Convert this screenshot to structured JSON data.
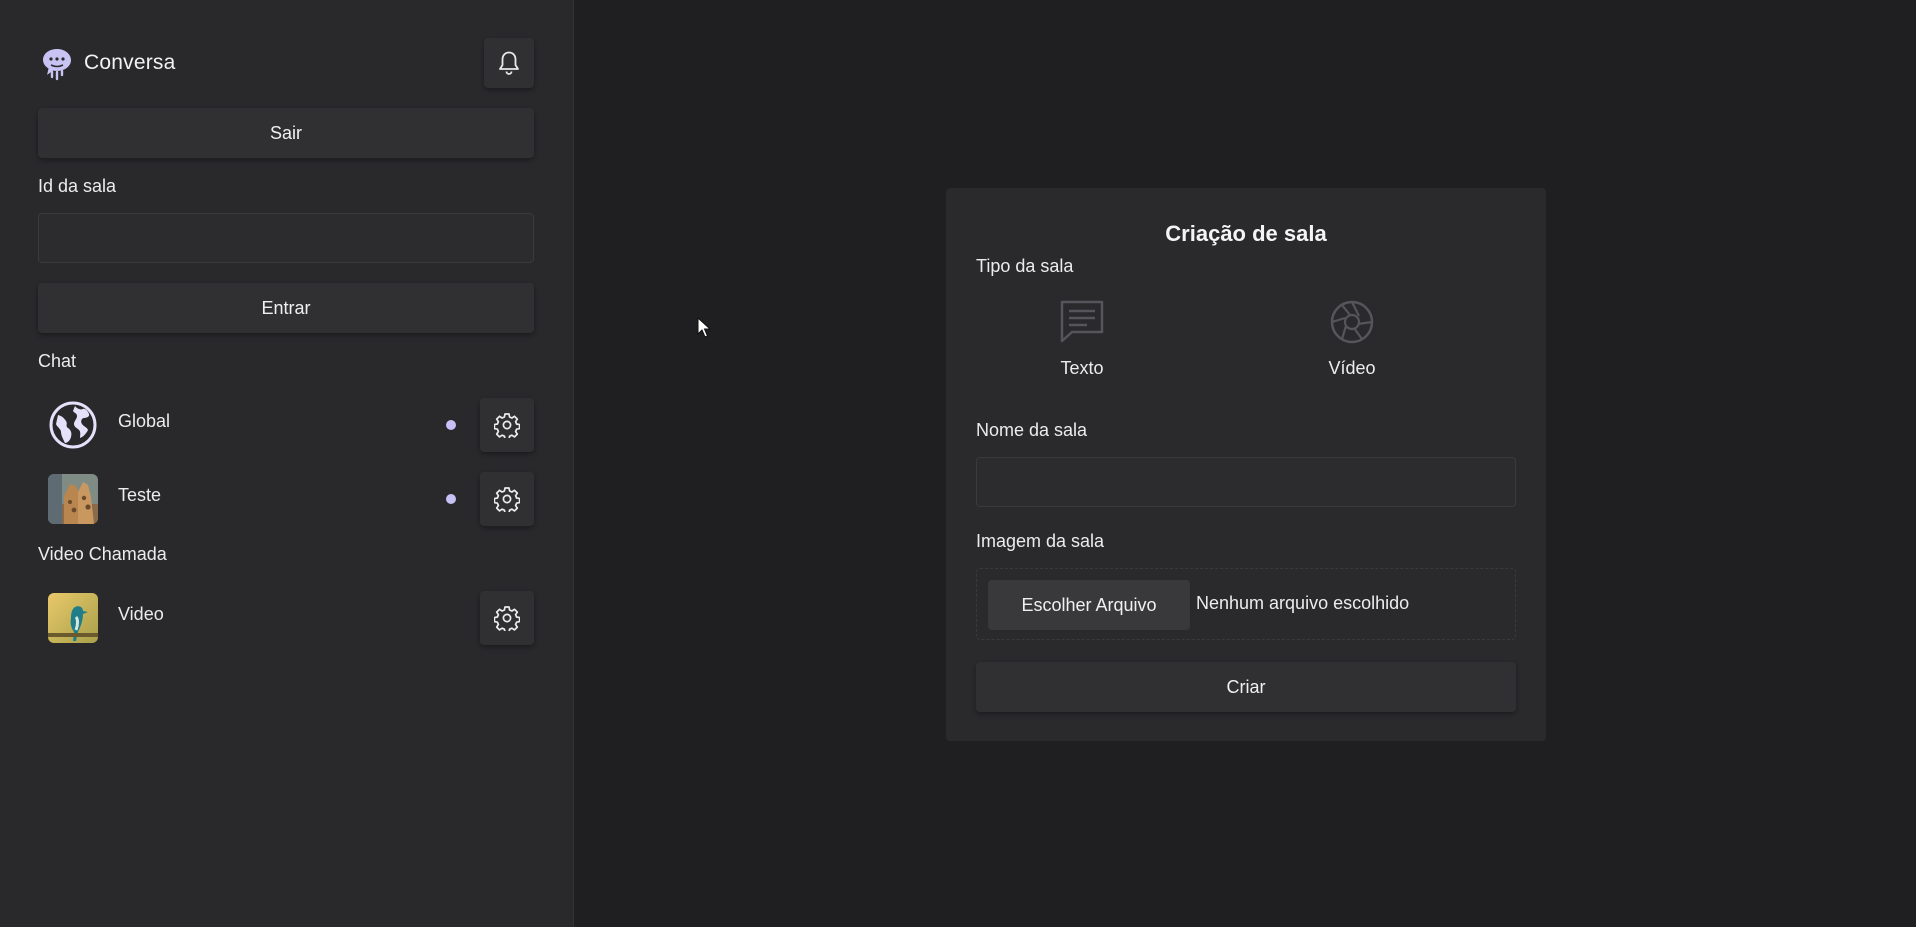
{
  "app": {
    "name": "Conversa",
    "logo_icon": "chat-bubble-logo-icon",
    "accent_color": "#c7c1f5"
  },
  "sidebar": {
    "notification_icon": "bell-icon",
    "logout_label": "Sair",
    "room_id_label": "Id da sala",
    "room_id_value": "",
    "enter_label": "Entrar",
    "sections": [
      {
        "title": "Chat",
        "rooms": [
          {
            "name": "Global",
            "avatar": "globe-icon",
            "unread": true,
            "settings_icon": "gear-icon"
          },
          {
            "name": "Teste",
            "avatar": "giraffe-photo",
            "unread": true,
            "settings_icon": "gear-icon"
          }
        ]
      },
      {
        "title": "Video Chamada",
        "rooms": [
          {
            "name": "Video",
            "avatar": "bird-photo",
            "unread": false,
            "settings_icon": "gear-icon"
          }
        ]
      }
    ]
  },
  "create_room": {
    "title": "Criação de sala",
    "type_label": "Tipo da sala",
    "types": [
      {
        "label": "Texto",
        "icon": "message-icon"
      },
      {
        "label": "Vídeo",
        "icon": "camera-aperture-icon"
      }
    ],
    "name_label": "Nome da sala",
    "name_value": "",
    "image_label": "Imagem da sala",
    "file_button_label": "Escolher Arquivo",
    "file_status": "Nenhum arquivo escolhido",
    "submit_label": "Criar"
  }
}
